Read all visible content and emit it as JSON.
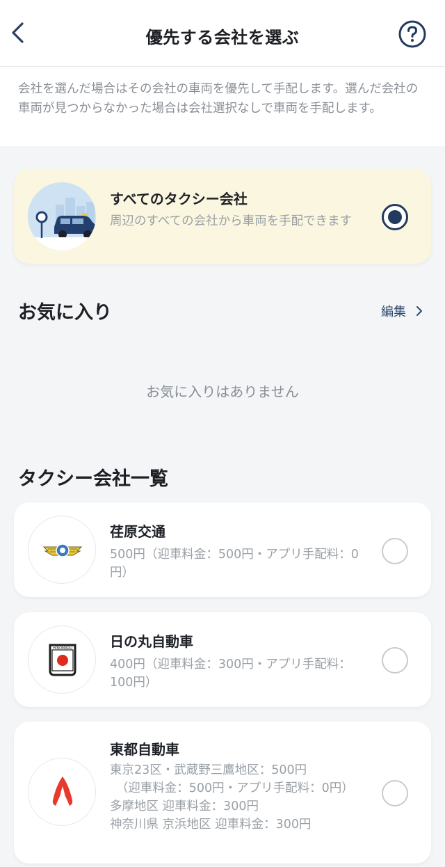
{
  "header": {
    "title": "優先する会社を選ぶ",
    "back_icon": "chevron-left-icon",
    "help_icon": "question-circle-icon"
  },
  "intro": {
    "text": "会社を選んだ場合はその会社の車両を優先して手配します。選んだ会社の車両が見つからなかった場合は会社選択なしで車両を手配します。"
  },
  "all_companies": {
    "title": "すべてのタクシー会社",
    "subtitle": "周辺のすべての会社から車両を手配できます",
    "selected": true
  },
  "favorites": {
    "title": "お気に入り",
    "edit_label": "編集",
    "empty_text": "お気に入りはありません"
  },
  "company_list": {
    "title": "タクシー会社一覧",
    "items": [
      {
        "name": "荏原交通",
        "detail": "500円（迎車料金：500円・アプリ手配料：0円）",
        "selected": false
      },
      {
        "name": "日の丸自動車",
        "detail": "400円（迎車料金：300円・アプリ手配料：100円）",
        "selected": false,
        "logo_text": "HINOMARU"
      },
      {
        "name": "東都自動車",
        "detail": "東京23区・武蔵野三鷹地区：500円\n　（迎車料金：500円・アプリ手配料：0円）\n多摩地区 迎車料金：300円\n神奈川県 京浜地区 迎車料金：300円",
        "selected": false
      }
    ]
  },
  "colors": {
    "accent_navy": "#223a5e",
    "highlight_bg": "#fbf6df",
    "hinomaru_red": "#e02a1e",
    "toto_red": "#e83a2c"
  }
}
